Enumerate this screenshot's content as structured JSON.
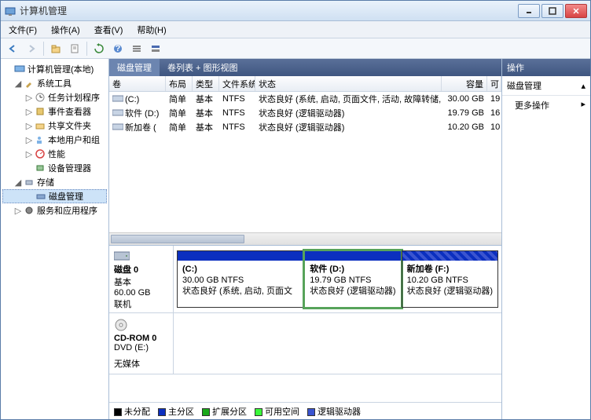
{
  "window": {
    "title": "计算机管理"
  },
  "menu": {
    "file": "文件(F)",
    "action": "操作(A)",
    "view": "查看(V)",
    "help": "帮助(H)"
  },
  "tree": {
    "root": "计算机管理(本地)",
    "systools": "系统工具",
    "task": "任务计划程序",
    "event": "事件查看器",
    "shared": "共享文件夹",
    "users": "本地用户和组",
    "perf": "性能",
    "devmgr": "设备管理器",
    "storage": "存储",
    "diskmgmt": "磁盘管理",
    "services": "服务和应用程序"
  },
  "tabs": {
    "disk": "磁盘管理",
    "vlist": "卷列表 + 图形视图"
  },
  "columns": {
    "vol": "卷",
    "layout": "布局",
    "type": "类型",
    "fs": "文件系统",
    "status": "状态",
    "cap": "容量",
    "free": "可"
  },
  "volumes": [
    {
      "name": "(C:)",
      "layout": "简单",
      "type": "基本",
      "fs": "NTFS",
      "status": "状态良好 (系统, 启动, 页面文件, 活动, 故障转储, 主分区)",
      "cap": "30.00 GB",
      "free": "19"
    },
    {
      "name": "软件 (D:)",
      "layout": "简单",
      "type": "基本",
      "fs": "NTFS",
      "status": "状态良好 (逻辑驱动器)",
      "cap": "19.79 GB",
      "free": "16"
    },
    {
      "name": "新加卷 (",
      "layout": "简单",
      "type": "基本",
      "fs": "NTFS",
      "status": "状态良好 (逻辑驱动器)",
      "cap": "10.20 GB",
      "free": "10"
    }
  ],
  "disk0": {
    "label": "磁盘 0",
    "type": "基本",
    "size": "60.00 GB",
    "state": "联机",
    "parts": [
      {
        "title": "(C:)",
        "sub": "30.00 GB NTFS",
        "status": "状态良好 (系统, 启动, 页面文"
      },
      {
        "title": "软件  (D:)",
        "sub": "19.79 GB NTFS",
        "status": "状态良好 (逻辑驱动器)"
      },
      {
        "title": "新加卷  (F:)",
        "sub": "10.20 GB NTFS",
        "status": "状态良好 (逻辑驱动器)"
      }
    ]
  },
  "cdrom": {
    "label": "CD-ROM 0",
    "sub": "DVD (E:)",
    "state": "无媒体"
  },
  "legend": {
    "unalloc": "未分配",
    "primary": "主分区",
    "ext": "扩展分区",
    "free": "可用空间",
    "logical": "逻辑驱动器"
  },
  "actions": {
    "hdr": "操作",
    "sub": "磁盘管理",
    "more": "更多操作"
  }
}
